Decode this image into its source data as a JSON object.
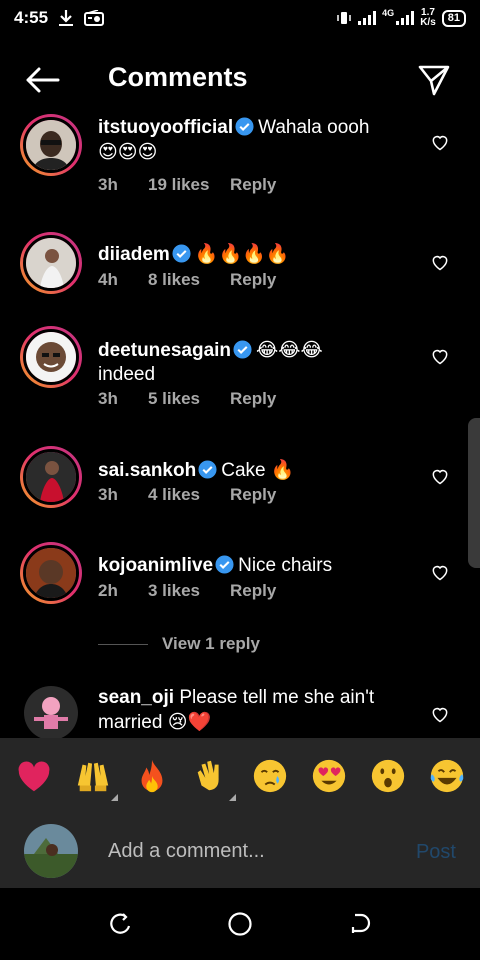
{
  "status_bar": {
    "time": "4:55",
    "network": "4G",
    "speed_value": "1.7",
    "speed_unit": "K/s",
    "battery": "81"
  },
  "header": {
    "title": "Comments"
  },
  "comments": [
    {
      "username": "itstuoyoofficial",
      "text": "Wahala oooh",
      "emoji": "😍😍😍",
      "time": "3h",
      "likes": "19 likes",
      "reply": "Reply"
    },
    {
      "username": "diiadem",
      "text": "",
      "emoji": "🔥🔥🔥🔥",
      "time": "4h",
      "likes": "8 likes",
      "reply": "Reply"
    },
    {
      "username": "deetunesagain",
      "text": "indeed",
      "emoji": "😂😂😂",
      "time": "3h",
      "likes": "5 likes",
      "reply": "Reply"
    },
    {
      "username": "sai.sankoh",
      "text": "Cake",
      "emoji": "🔥",
      "time": "3h",
      "likes": "4 likes",
      "reply": "Reply"
    },
    {
      "username": "kojoanimlive",
      "text": "Nice chairs",
      "emoji": "",
      "time": "2h",
      "likes": "3 likes",
      "reply": "Reply"
    },
    {
      "username": "sean_oji",
      "text": "Please tell me she ain't married",
      "emoji": "😢❤️"
    }
  ],
  "view_replies": "View 1 reply",
  "emoji_bar": [
    "heart",
    "raised-hands",
    "fire",
    "clap",
    "cry",
    "heart-eyes",
    "surprised",
    "laugh"
  ],
  "input": {
    "placeholder": "Add a comment...",
    "post_label": "Post"
  },
  "colors": {
    "accent": "#21486b",
    "bar_bg": "#262626",
    "verified": "#3897f0"
  }
}
